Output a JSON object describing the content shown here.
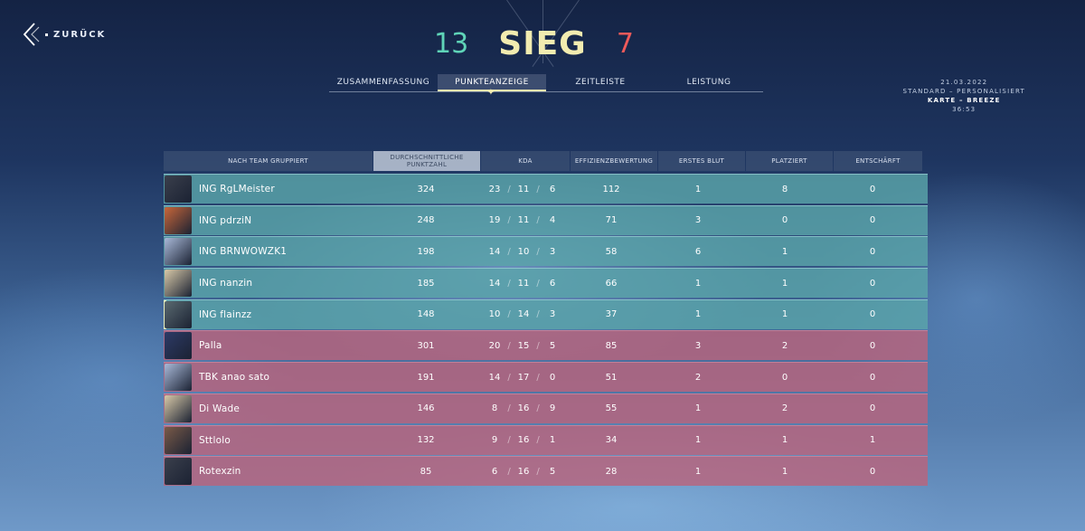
{
  "header": {
    "back_label": "ZURÜCK",
    "score_team": "13",
    "result": "SIEG",
    "score_enemy": "7"
  },
  "tabs": [
    {
      "label": "ZUSAMMENFASSUNG",
      "active": false
    },
    {
      "label": "PUNKTEANZEIGE",
      "active": true
    },
    {
      "label": "ZEITLEISTE",
      "active": false
    },
    {
      "label": "LEISTUNG",
      "active": false
    }
  ],
  "match_info": {
    "date": "21.03.2022",
    "mode": "STANDARD – PERSONALISIERT",
    "map": "KARTE – BREEZE",
    "duration": "36:53"
  },
  "table": {
    "columns": {
      "name": "NACH TEAM GRUPPIERT",
      "acs": "DURCHSCHNITTLICHE PUNKTZAHL",
      "kda": "KDA",
      "eff": "EFFIZIENZBEWERTUNG",
      "first_blood": "ERSTES BLUT",
      "planted": "PLATZIERT",
      "defused": "ENTSCHÄRFT"
    },
    "rows": [
      {
        "team": "a",
        "name": "ING RgLMeister",
        "acs": "324",
        "k": "23",
        "d": "11",
        "a": "6",
        "eff": "112",
        "fb": "1",
        "pl": "8",
        "df": "0",
        "avatar_color": "#3a3f4c"
      },
      {
        "team": "a",
        "name": "ING pdrziN",
        "acs": "248",
        "k": "19",
        "d": "11",
        "a": "4",
        "eff": "71",
        "fb": "3",
        "pl": "0",
        "df": "0",
        "avatar_color": "#c8663a"
      },
      {
        "team": "a",
        "name": "ING BRNWOWZK1",
        "acs": "198",
        "k": "14",
        "d": "10",
        "a": "3",
        "eff": "58",
        "fb": "6",
        "pl": "1",
        "df": "0",
        "avatar_color": "#a9b9d8"
      },
      {
        "team": "a",
        "name": "ING nanzin",
        "acs": "185",
        "k": "14",
        "d": "11",
        "a": "6",
        "eff": "66",
        "fb": "1",
        "pl": "1",
        "df": "0",
        "avatar_color": "#d8c9a8"
      },
      {
        "team": "a",
        "name": "ING flainzz",
        "acs": "148",
        "k": "10",
        "d": "14",
        "a": "3",
        "eff": "37",
        "fb": "1",
        "pl": "1",
        "df": "0",
        "avatar_color": "#5a6a70"
      },
      {
        "team": "b",
        "name": "Palla",
        "acs": "301",
        "k": "20",
        "d": "15",
        "a": "5",
        "eff": "85",
        "fb": "3",
        "pl": "2",
        "df": "0",
        "avatar_color": "#2d3a66"
      },
      {
        "team": "b",
        "name": "TBK anao sato",
        "acs": "191",
        "k": "14",
        "d": "17",
        "a": "0",
        "eff": "51",
        "fb": "2",
        "pl": "0",
        "df": "0",
        "avatar_color": "#a9b9d8"
      },
      {
        "team": "b",
        "name": "Di Wade",
        "acs": "146",
        "k": "8",
        "d": "16",
        "a": "9",
        "eff": "55",
        "fb": "1",
        "pl": "2",
        "df": "0",
        "avatar_color": "#d8c9a8"
      },
      {
        "team": "b",
        "name": "Sttlolo",
        "acs": "132",
        "k": "9",
        "d": "16",
        "a": "1",
        "eff": "34",
        "fb": "1",
        "pl": "1",
        "df": "1",
        "avatar_color": "#7a5a48"
      },
      {
        "team": "b",
        "name": "Rotexzin",
        "acs": "85",
        "k": "6",
        "d": "16",
        "a": "5",
        "eff": "28",
        "fb": "1",
        "pl": "1",
        "df": "0",
        "avatar_color": "#3a3f4c"
      }
    ]
  },
  "colors": {
    "win": "#5fd4b8",
    "result": "#f2ecb0",
    "lose": "#ef5a5a",
    "team_a_row": "#5aa5aa",
    "team_b_row": "#b9647d"
  }
}
